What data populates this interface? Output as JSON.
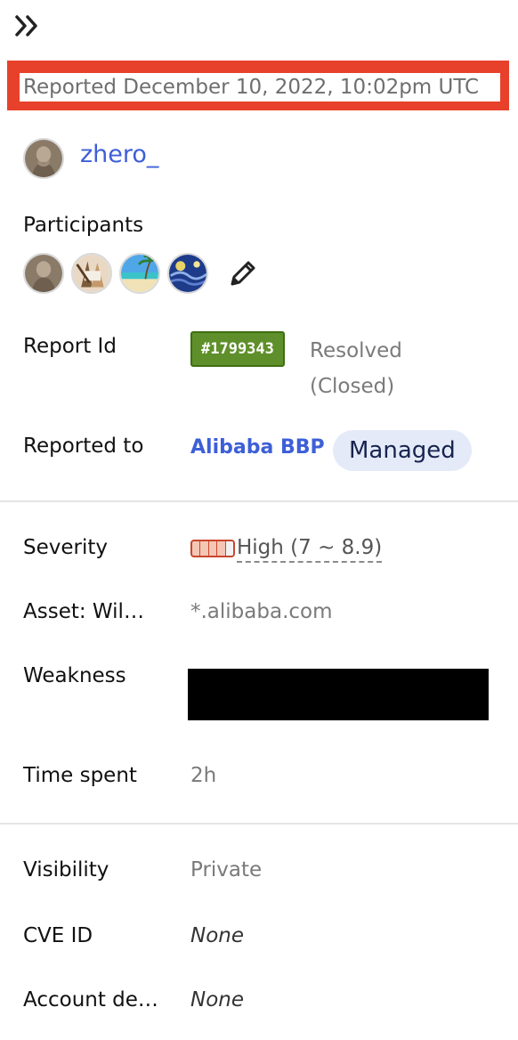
{
  "header": {
    "reported_text": "Reported December 10, 2022, 10:02pm UTC"
  },
  "reporter": {
    "username": "zhero_"
  },
  "participants": {
    "label": "Participants",
    "avatars": [
      "avatar-reporter",
      "avatar-anime",
      "avatar-beach",
      "avatar-starry-night"
    ]
  },
  "report": {
    "id_label": "Report Id",
    "id_value": "#1799343",
    "status_line1": "Resolved",
    "status_line2": "(Closed)"
  },
  "reported_to": {
    "label": "Reported to",
    "program": "Alibaba BBP",
    "badge": "Managed"
  },
  "details": {
    "severity_label": "Severity",
    "severity_value": "High (7 ~ 8.9)",
    "severity_filled_segments": 4,
    "severity_total_segments": 5,
    "asset_label": "Asset: Wil…",
    "asset_value": "*.alibaba.com",
    "weakness_label": "Weakness",
    "time_label": "Time spent",
    "time_value": "2h"
  },
  "meta": {
    "visibility_label": "Visibility",
    "visibility_value": "Private",
    "cve_label": "CVE ID",
    "cve_value": "None",
    "account_label": "Account de…",
    "account_value": "None"
  },
  "colors": {
    "highlight_border": "#e8412b",
    "link": "#3d5fd7",
    "id_badge": "#5f8f2a",
    "managed_pill": "#e4eaf8",
    "severity_high": "#c8472d"
  },
  "icons": {
    "collapse": "double-chevron-right-icon",
    "edit": "pencil-icon"
  }
}
